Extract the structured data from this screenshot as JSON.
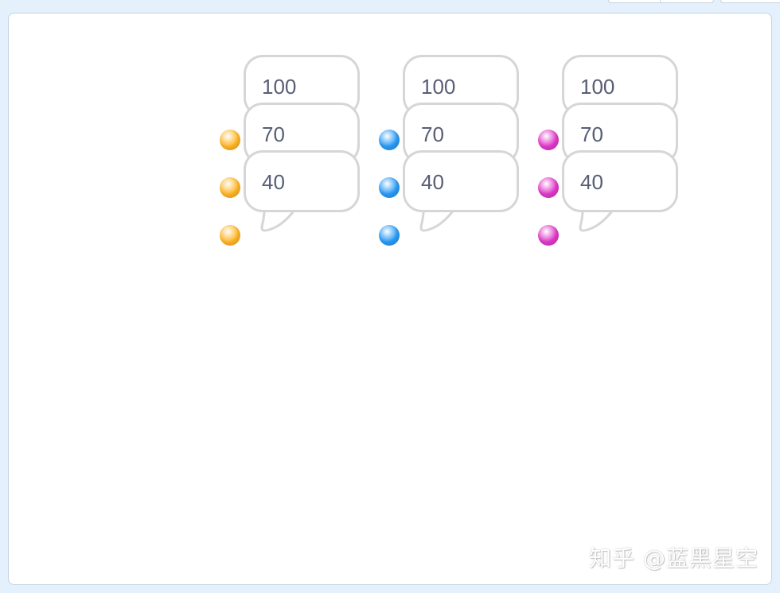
{
  "stage": {
    "watermark": "知乎 @蓝黑星空"
  },
  "sprites": [
    {
      "color_name": "orange",
      "color": "#ffb627",
      "bubbles": [
        "100",
        "70",
        "40"
      ]
    },
    {
      "color_name": "blue",
      "color": "#2a9bf7",
      "bubbles": [
        "100",
        "70",
        "40"
      ]
    },
    {
      "color_name": "magenta",
      "color": "#e03ac9",
      "bubbles": [
        "100",
        "70",
        "40"
      ]
    }
  ]
}
